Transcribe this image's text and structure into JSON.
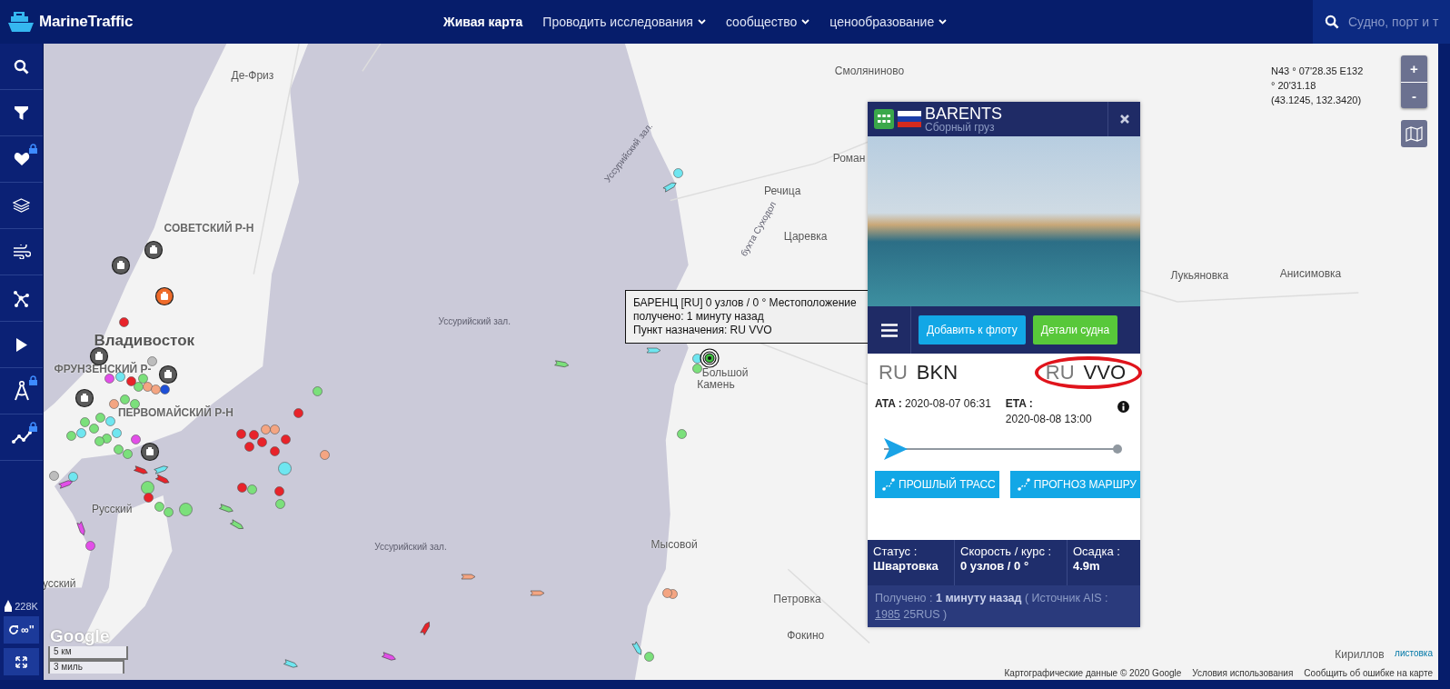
{
  "topbar": {
    "logo": "MarineTraffic",
    "nav": [
      {
        "label": "Живая карта",
        "selected": true,
        "dropdown": false
      },
      {
        "label": "Проводить исследования",
        "selected": false,
        "dropdown": true
      },
      {
        "label": "сообщество",
        "selected": false,
        "dropdown": true
      },
      {
        "label": "ценообразование",
        "selected": false,
        "dropdown": true
      }
    ],
    "search": {
      "placeholder": "Судно, порт и т"
    }
  },
  "sidebar": {
    "tools": [
      {
        "kind": "search",
        "locked": false
      },
      {
        "kind": "filter",
        "locked": false
      },
      {
        "kind": "heart",
        "locked": true
      },
      {
        "kind": "layers",
        "locked": false
      },
      {
        "kind": "wind",
        "locked": false
      },
      {
        "kind": "network",
        "locked": false
      },
      {
        "kind": "play",
        "locked": false
      },
      {
        "kind": "compass",
        "locked": true
      },
      {
        "kind": "chart",
        "locked": true
      }
    ],
    "vessel_count": "228K",
    "refresh_label": "∞''"
  },
  "map": {
    "labels": [
      {
        "text": "Де-Фриз",
        "kind": "place"
      },
      {
        "text": "Смоляниново",
        "kind": "place"
      },
      {
        "text": "Роман",
        "kind": "place"
      },
      {
        "text": "Уссурийский зал.",
        "kind": "water"
      },
      {
        "text": "Речица",
        "kind": "place"
      },
      {
        "text": "бухта Суходол",
        "kind": "water"
      },
      {
        "text": "Царевка",
        "kind": "place"
      },
      {
        "text": "Лукьяновка",
        "kind": "place"
      },
      {
        "text": "Анисимовка",
        "kind": "place"
      },
      {
        "text": "СОВЕТСКИЙ Р-Н",
        "kind": "district"
      },
      {
        "text": "Владивосток",
        "kind": "city"
      },
      {
        "text": "Уссурийский зал.",
        "kind": "water"
      },
      {
        "text": "Большой",
        "kind": "place"
      },
      {
        "text": "Камень",
        "kind": "place"
      },
      {
        "text": "ФРУНЗЕНСКИЙ Р-",
        "kind": "district"
      },
      {
        "text": "ПЕРВОМАЙСКИЙ Р-Н",
        "kind": "district"
      },
      {
        "text": "Русский",
        "kind": "place"
      },
      {
        "text": "усский",
        "kind": "place"
      },
      {
        "text": "Уссурийский зал.",
        "kind": "water"
      },
      {
        "text": "Мысовой",
        "kind": "place"
      },
      {
        "text": "Петровка",
        "kind": "place"
      },
      {
        "text": "Фокино",
        "kind": "place"
      },
      {
        "text": "Кириллов",
        "kind": "place"
      }
    ],
    "vessels": [
      {
        "kind": "dot",
        "color": "#e8232a"
      },
      {
        "kind": "dot",
        "color": "#6fe6f0"
      },
      {
        "kind": "arrow",
        "color": "#6fe6f0"
      },
      {
        "kind": "dot",
        "color": "#7be07b"
      },
      {
        "kind": "dot",
        "color": "#e8232a"
      },
      {
        "kind": "dot",
        "color": "#e8232a"
      },
      {
        "kind": "dot",
        "color": "#e8232a"
      },
      {
        "kind": "dot",
        "color": "#f4a582"
      },
      {
        "kind": "dot",
        "color": "#f4a582"
      },
      {
        "kind": "dot",
        "color": "#e8232a"
      },
      {
        "kind": "dot",
        "color": "#e8232a"
      },
      {
        "kind": "dot",
        "color": "#e8232a"
      },
      {
        "kind": "dot",
        "color": "#e8232a"
      },
      {
        "kind": "dot",
        "color": "#f4a582"
      },
      {
        "kind": "large-dot",
        "color": "#6fe6f0"
      },
      {
        "kind": "dot",
        "color": "#e8232a"
      },
      {
        "kind": "dot",
        "color": "#7be07b"
      },
      {
        "kind": "dot",
        "color": "#e8232a"
      },
      {
        "kind": "dot",
        "color": "#7be07b"
      },
      {
        "kind": "large-dot",
        "color": "#7be07b"
      },
      {
        "kind": "dot",
        "color": "#7be07b"
      },
      {
        "kind": "dot",
        "color": "#7be07b"
      },
      {
        "kind": "large-dot",
        "color": "#7be07b"
      },
      {
        "kind": "dot",
        "color": "#e8232a"
      },
      {
        "kind": "dot",
        "color": "#7be07b"
      },
      {
        "kind": "dot",
        "color": "#7be07b"
      },
      {
        "kind": "dot",
        "color": "#7be07b"
      },
      {
        "kind": "dot",
        "color": "#6fe6f0"
      },
      {
        "kind": "dot",
        "color": "#7be07b"
      },
      {
        "kind": "dot",
        "color": "#6fe6f0"
      },
      {
        "kind": "dot",
        "color": "#f4a582"
      },
      {
        "kind": "dot",
        "color": "#7be07b"
      },
      {
        "kind": "dot",
        "color": "#7be07b"
      },
      {
        "kind": "dot",
        "color": "#7be07b"
      },
      {
        "kind": "dot",
        "color": "#e24ee8"
      },
      {
        "kind": "dot",
        "color": "#6fe6f0"
      },
      {
        "kind": "dot",
        "color": "#e8232a"
      },
      {
        "kind": "dot",
        "color": "#7be07b"
      },
      {
        "kind": "dot",
        "color": "#f4a582"
      },
      {
        "kind": "dot",
        "color": "#7be07b"
      },
      {
        "kind": "dot",
        "color": "#7be07b"
      },
      {
        "kind": "dot",
        "color": "#6fe6f0"
      },
      {
        "kind": "dot",
        "color": "#7be07b"
      },
      {
        "kind": "dot",
        "color": "#7be07b"
      },
      {
        "kind": "dot",
        "color": "#e24ee8"
      },
      {
        "kind": "dot",
        "color": "#bdbdbd"
      },
      {
        "kind": "dot",
        "color": "#6fe6f0"
      },
      {
        "kind": "dot",
        "color": "#e24ee8"
      },
      {
        "kind": "dot",
        "color": "#bdbdbd"
      },
      {
        "kind": "dot",
        "color": "#1d4fd8"
      },
      {
        "kind": "dot",
        "color": "#f4a582"
      },
      {
        "kind": "dot",
        "color": "#7be07b"
      },
      {
        "kind": "dot",
        "color": "#6fe6f0"
      },
      {
        "kind": "dot",
        "color": "#7be07b"
      },
      {
        "kind": "dot",
        "color": "#f4a582"
      },
      {
        "kind": "dot",
        "color": "#f4a582"
      },
      {
        "kind": "dot",
        "color": "#7be07b"
      },
      {
        "kind": "arrow",
        "color": "#7be07b"
      },
      {
        "kind": "arrow",
        "color": "#6fe6f0"
      },
      {
        "kind": "arrow",
        "color": "#e8232a"
      },
      {
        "kind": "arrow",
        "color": "#e8232a"
      },
      {
        "kind": "arrow",
        "color": "#6fe6f0"
      },
      {
        "kind": "arrow",
        "color": "#7be07b"
      },
      {
        "kind": "arrow",
        "color": "#7be07b"
      },
      {
        "kind": "arrow",
        "color": "#e24ee8"
      },
      {
        "kind": "arrow",
        "color": "#e24ee8"
      },
      {
        "kind": "arrow",
        "color": "#f4a582"
      },
      {
        "kind": "arrow",
        "color": "#f4a582"
      },
      {
        "kind": "arrow",
        "color": "#e8232a"
      },
      {
        "kind": "arrow",
        "color": "#e24ee8"
      },
      {
        "kind": "arrow",
        "color": "#6fe6f0"
      },
      {
        "kind": "arrow",
        "color": "#6fe6f0"
      },
      {
        "kind": "poi",
        "color": "#5a5a5a"
      },
      {
        "kind": "poi",
        "color": "#5a5a5a"
      },
      {
        "kind": "poi",
        "color": "#ef6b2a"
      },
      {
        "kind": "poi",
        "color": "#5a5a5a"
      },
      {
        "kind": "poi",
        "color": "#5a5a5a"
      },
      {
        "kind": "poi",
        "color": "#5a5a5a"
      },
      {
        "kind": "poi",
        "color": "#5a5a5a"
      },
      {
        "kind": "target",
        "color": "#3fbf3f"
      }
    ],
    "tooltip": {
      "lines": [
        "БАРЕНЦ [RU] 0 узлов / 0 ° Местоположение",
        "получено: 1 минуту назад",
        "Пункт назначения: RU VVO"
      ]
    },
    "coordinates": {
      "lines": [
        "N43 ° 07'28.35 E132",
        "° 20'31.18",
        "(43.1245, 132.3420)"
      ]
    },
    "zoom_in": "+",
    "zoom_out": "-",
    "google_logo": "Google",
    "scale": [
      "5 км",
      "3 миль"
    ],
    "leaflet_link": "листовка",
    "attribution": [
      "Картографические данные © 2020 Google",
      "Условия использования",
      "Сообщить об ошибке на карте"
    ]
  },
  "vessel_panel": {
    "name": "BARENTS",
    "type": "Сборный груз",
    "actions": [
      {
        "label": "Добавить к флоту",
        "kind": "fleet"
      },
      {
        "label": "Детали судна",
        "kind": "details"
      }
    ],
    "origin": {
      "country": "RU",
      "port": "BKN",
      "highlighted": false
    },
    "destination": {
      "country": "RU",
      "port": "VVO",
      "highlighted": true
    },
    "ata": {
      "label": "ATA :",
      "value": "2020-08-07 06:31"
    },
    "eta": {
      "label": "ETA :",
      "value": "2020-08-08 13:00"
    },
    "progress": {
      "level": 0
    },
    "route_buttons": [
      "ПРОШЛЫЙ ТРАСС",
      "ПРОГНОЗ МАРШРУ"
    ],
    "stats": [
      {
        "label": "Статус :",
        "value": "Швартовка"
      },
      {
        "label": "Скорость / курс :",
        "value": "0 узлов / 0 °"
      },
      {
        "label": "Осадка :",
        "value": "4.9m"
      }
    ],
    "received": {
      "before": "Получено : **1 минуту назад** ( Источник AIS :",
      "link": "1985",
      "after": "25RUS )"
    }
  }
}
